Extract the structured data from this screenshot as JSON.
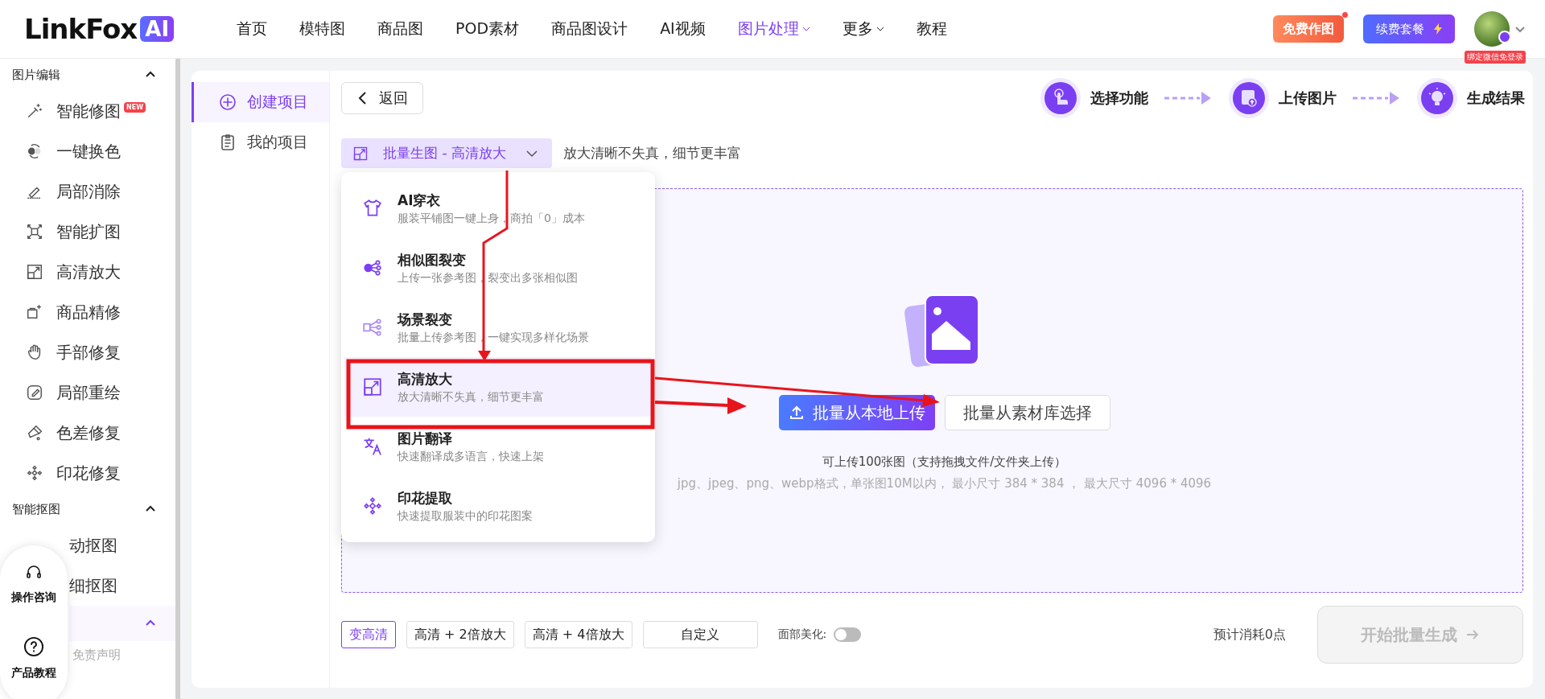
{
  "header": {
    "logo": {
      "name": "LinkFox",
      "badge": "AI"
    },
    "nav": [
      {
        "label": "首页",
        "selected": false,
        "dropdown": false
      },
      {
        "label": "模特图",
        "selected": false,
        "dropdown": false
      },
      {
        "label": "商品图",
        "selected": false,
        "dropdown": false
      },
      {
        "label": "POD素材",
        "selected": false,
        "dropdown": false
      },
      {
        "label": "商品图设计",
        "selected": false,
        "dropdown": false
      },
      {
        "label": "AI视频",
        "selected": false,
        "dropdown": false
      },
      {
        "label": "图片处理",
        "selected": true,
        "dropdown": true
      },
      {
        "label": "更多",
        "selected": false,
        "dropdown": true
      },
      {
        "label": "教程",
        "selected": false,
        "dropdown": false
      }
    ],
    "free_button": "免费作图",
    "renew_button": "续费套餐",
    "avatar_badge": "绑定微信免登录"
  },
  "sidebar": {
    "sections": [
      {
        "title": "图片编辑",
        "expanded": true,
        "items": [
          {
            "label": "智能修图",
            "badge": "NEW"
          },
          {
            "label": "一键换色"
          },
          {
            "label": "局部消除"
          },
          {
            "label": "智能扩图"
          },
          {
            "label": "高清放大"
          },
          {
            "label": "商品精修"
          },
          {
            "label": "手部修复"
          },
          {
            "label": "局部重绘"
          },
          {
            "label": "色差修复"
          },
          {
            "label": "印花修复"
          }
        ]
      },
      {
        "title": "智能抠图",
        "expanded": true,
        "items": [
          {
            "label": "动抠图"
          },
          {
            "label": "细抠图"
          }
        ]
      },
      {
        "expanded": true,
        "active": true
      }
    ],
    "footer_link": "免责声明"
  },
  "help_widget": [
    {
      "label": "操作咨询"
    },
    {
      "label": "产品教程"
    }
  ],
  "project_nav": [
    {
      "label": "创建项目",
      "selected": true
    },
    {
      "label": "我的项目",
      "selected": false
    }
  ],
  "back_button": "返回",
  "steps": [
    {
      "label": "选择功能"
    },
    {
      "label": "上传图片"
    },
    {
      "label": "生成结果"
    }
  ],
  "mode_select": {
    "value": "批量生图 - 高清放大",
    "description": "放大清晰不失真，细节更丰富",
    "expanded": true
  },
  "mode_menu": [
    {
      "title": "AI穿衣",
      "subtitle": "服装平铺图一键上身，商拍「0」成本",
      "selected": false
    },
    {
      "title": "相似图裂变",
      "subtitle": "上传一张参考图，裂变出多张相似图",
      "selected": false
    },
    {
      "title": "场景裂变",
      "subtitle": "批量上传参考图，一键实现多样化场景",
      "selected": false
    },
    {
      "title": "高清放大",
      "subtitle": "放大清晰不失真，细节更丰富",
      "selected": true
    },
    {
      "title": "图片翻译",
      "subtitle": "快速翻译成多语言，快速上架",
      "selected": false
    },
    {
      "title": "印花提取",
      "subtitle": "快速提取服装中的印花图案",
      "selected": false
    }
  ],
  "upload": {
    "local_button": "批量从本地上传",
    "library_button": "批量从素材库选择",
    "hint": "可上传100张图（支持拖拽文件/文件夹上传）",
    "formats": "jpg、jpeg、png、webp格式，单张图10M以内， 最小尺寸 384 * 384 ， 最大尺寸 4096 * 4096"
  },
  "bottom_bar": {
    "presets": [
      {
        "label": "变高清",
        "selected": true
      },
      {
        "label": "高清 + 2倍放大",
        "selected": false
      },
      {
        "label": "高清 + 4倍放大",
        "selected": false
      },
      {
        "label": "自定义",
        "selected": false
      }
    ],
    "face_beautify": {
      "label": "面部美化:",
      "on": false
    },
    "cost": "预计消耗0点",
    "start_button": {
      "label": "开始批量生成",
      "disabled": true
    }
  }
}
